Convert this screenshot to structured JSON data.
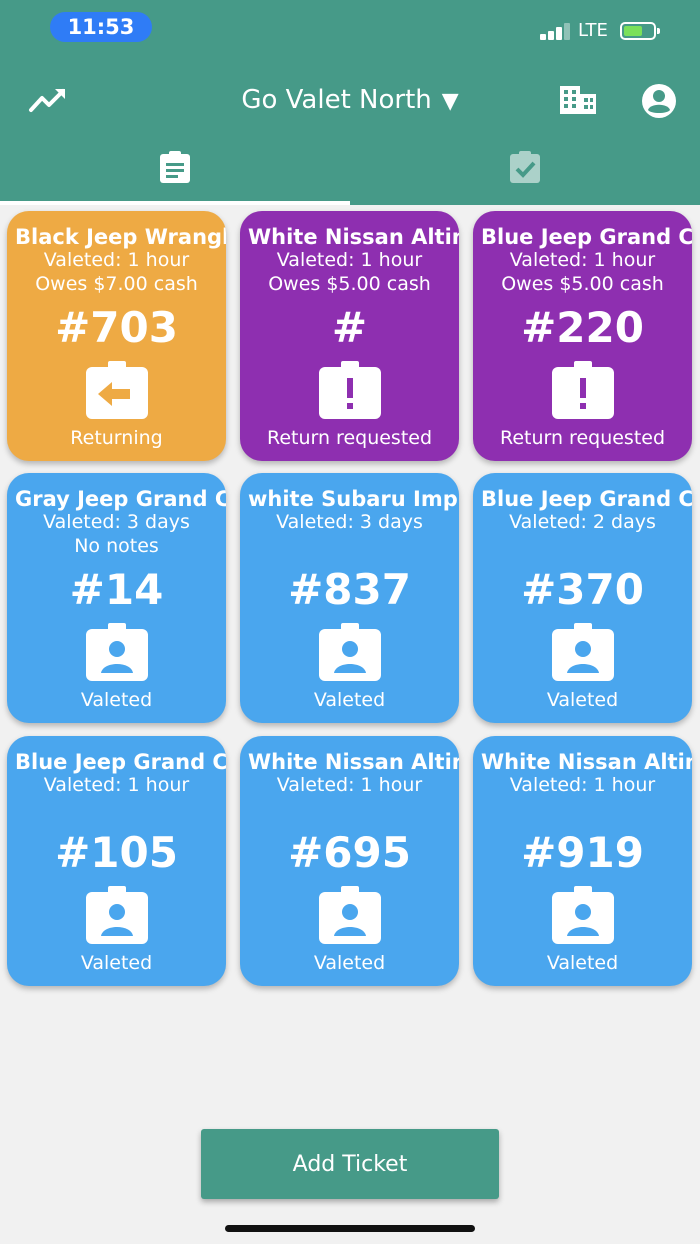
{
  "status_bar": {
    "time": "11:53",
    "network": "LTE"
  },
  "header": {
    "location": "Go Valet North",
    "caret": "▼"
  },
  "colors": {
    "header": "#469a88",
    "returning": "#eeaa44",
    "requested": "#8e2fb0",
    "valeted": "#4aa6ee"
  },
  "tickets": [
    {
      "vehicle": "Black Jeep Wrangler",
      "line1": "Valeted: 1 hour",
      "line2": "Owes $7.00 cash",
      "number": "#703",
      "status": "Returning",
      "icon": "return-arrow-icon",
      "color": "#eeaa44"
    },
    {
      "vehicle": "White Nissan Altima",
      "line1": "Valeted: 1 hour",
      "line2": "Owes $5.00 cash",
      "number": "#",
      "status": "Return requested",
      "icon": "alert-badge-icon",
      "color": "#8e2fb0"
    },
    {
      "vehicle": "Blue Jeep Grand Cherokee",
      "line1": "Valeted: 1 hour",
      "line2": "Owes $5.00 cash",
      "number": "#220",
      "status": "Return requested",
      "icon": "alert-badge-icon",
      "color": "#8e2fb0"
    },
    {
      "vehicle": "Gray Jeep Grand Cherokee",
      "line1": "Valeted: 3 days",
      "line2": "No notes",
      "number": "#14",
      "status": "Valeted",
      "icon": "badge-person-icon",
      "color": "#4aa6ee"
    },
    {
      "vehicle": "white Subaru Impreza",
      "line1": "Valeted: 3 days",
      "line2": "",
      "number": "#837",
      "status": "Valeted",
      "icon": "badge-person-icon",
      "color": "#4aa6ee"
    },
    {
      "vehicle": "Blue Jeep Grand Cherokee",
      "line1": "Valeted: 2 days",
      "line2": "",
      "number": "#370",
      "status": "Valeted",
      "icon": "badge-person-icon",
      "color": "#4aa6ee"
    },
    {
      "vehicle": "Blue Jeep Grand Cherokee",
      "line1": "Valeted: 1 hour",
      "line2": "",
      "number": "#105",
      "status": "Valeted",
      "icon": "badge-person-icon",
      "color": "#4aa6ee"
    },
    {
      "vehicle": "White Nissan Altima",
      "line1": "Valeted: 1 hour",
      "line2": "",
      "number": "#695",
      "status": "Valeted",
      "icon": "badge-person-icon",
      "color": "#4aa6ee"
    },
    {
      "vehicle": "White Nissan Altima",
      "line1": "Valeted: 1 hour",
      "line2": "",
      "number": "#919",
      "status": "Valeted",
      "icon": "badge-person-icon",
      "color": "#4aa6ee"
    }
  ],
  "footer": {
    "add_ticket_label": "Add Ticket"
  }
}
